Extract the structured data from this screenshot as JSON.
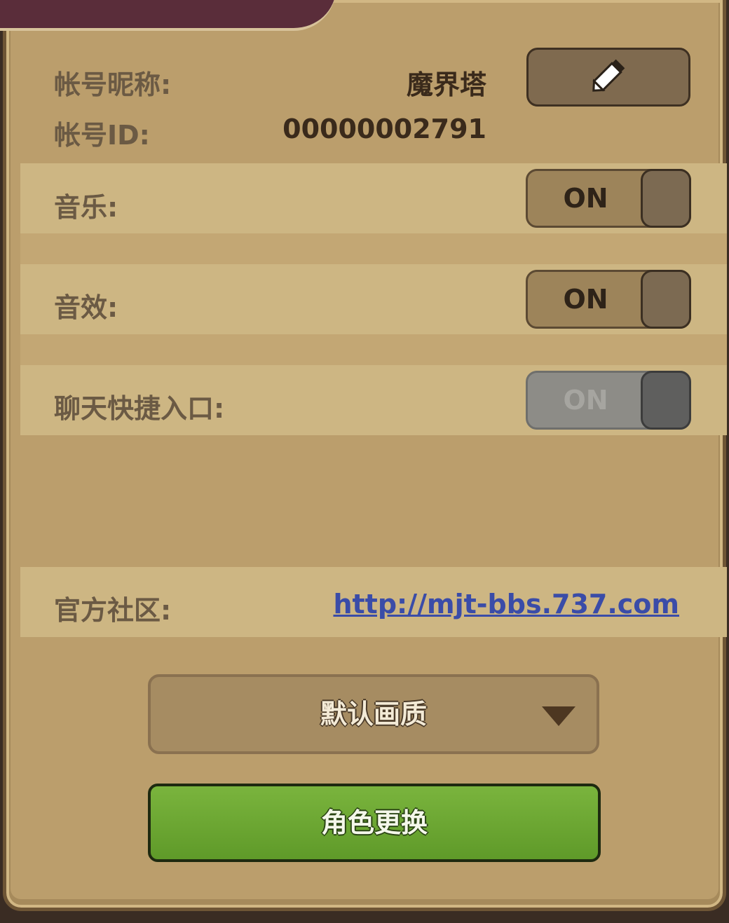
{
  "account": {
    "nickname_label": "帐号昵称:",
    "nickname_value": "魔界塔",
    "id_label": "帐号ID:",
    "id_value": "00000002791"
  },
  "settings": {
    "music_label": "音乐:",
    "music_state": "ON",
    "sfx_label": "音效:",
    "sfx_state": "ON",
    "chat_label": "聊天快捷入口:",
    "chat_state": "ON"
  },
  "community": {
    "label": "官方社区:",
    "url": "http://mjt-bbs.737.com"
  },
  "quality_dropdown": {
    "selected": "默认画质"
  },
  "switch_role_button": {
    "label": "角色更换"
  },
  "icons": {
    "edit": "pencil-icon",
    "dropdown_arrow": "chevron-down-icon"
  },
  "colors": {
    "panel": "#bb9e6c",
    "band": "#cdb683",
    "green_button": "#6aa632",
    "link": "#3a4ca8"
  }
}
